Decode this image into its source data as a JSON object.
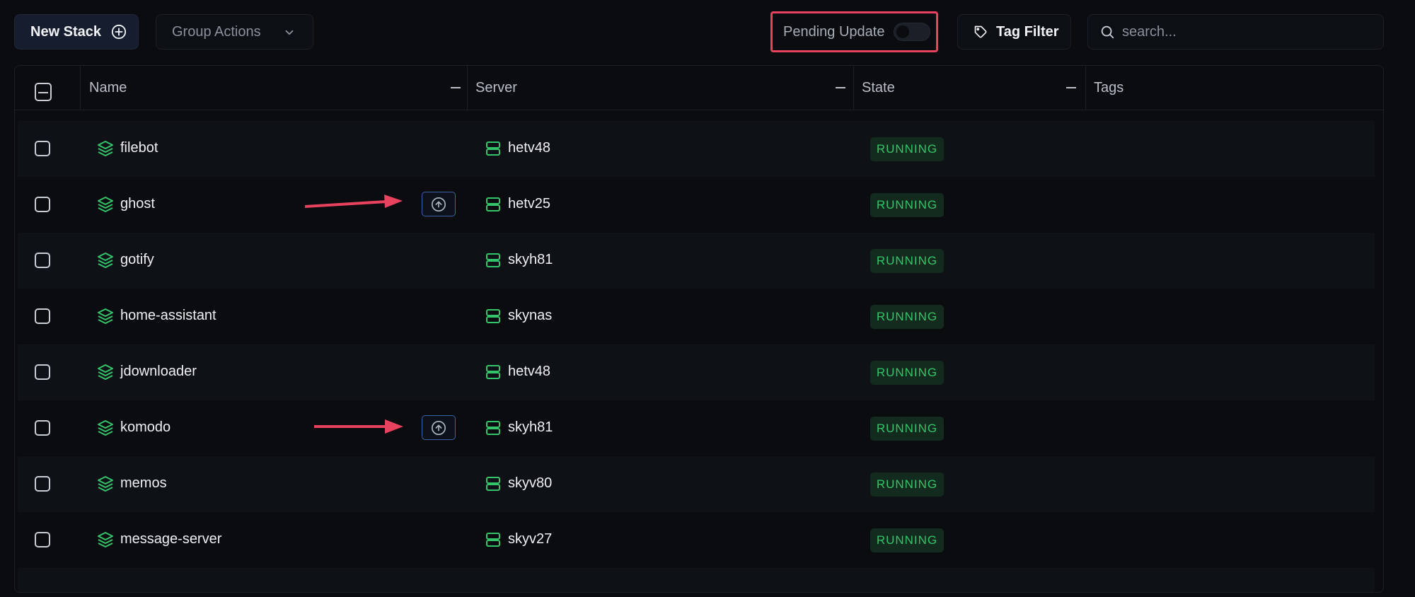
{
  "toolbar": {
    "new_stack_label": "New Stack",
    "group_actions_label": "Group Actions",
    "pending_update_label": "Pending Update",
    "pending_update_on": false,
    "tag_filter_label": "Tag Filter",
    "search_placeholder": "search..."
  },
  "table": {
    "columns": [
      "Name",
      "Server",
      "State",
      "Tags"
    ],
    "rows": [
      {
        "name": "filebot",
        "server": "hetv48",
        "state": "RUNNING",
        "update_available": false
      },
      {
        "name": "ghost",
        "server": "hetv25",
        "state": "RUNNING",
        "update_available": true
      },
      {
        "name": "gotify",
        "server": "skyh81",
        "state": "RUNNING",
        "update_available": false
      },
      {
        "name": "home-assistant",
        "server": "skynas",
        "state": "RUNNING",
        "update_available": false
      },
      {
        "name": "jdownloader",
        "server": "hetv48",
        "state": "RUNNING",
        "update_available": false
      },
      {
        "name": "komodo",
        "server": "skyh81",
        "state": "RUNNING",
        "update_available": true
      },
      {
        "name": "memos",
        "server": "skyv80",
        "state": "RUNNING",
        "update_available": false
      },
      {
        "name": "message-server",
        "server": "skyv27",
        "state": "RUNNING",
        "update_available": false
      }
    ]
  },
  "colors": {
    "accent_green": "#34c46a",
    "highlight_red": "#e8425e",
    "update_blue": "#3a64a8"
  }
}
